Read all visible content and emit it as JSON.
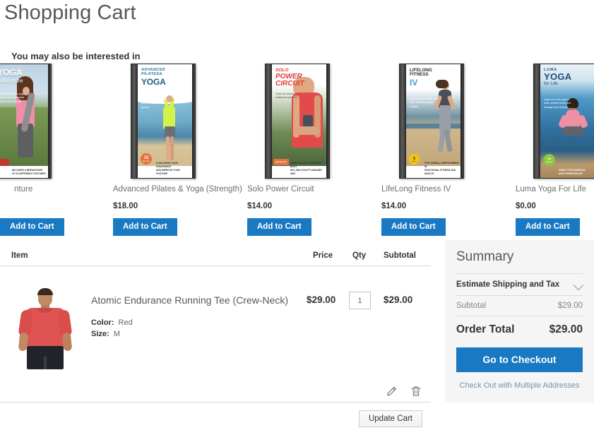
{
  "page": {
    "title": "Shopping Cart"
  },
  "upsell": {
    "heading": "You may also be interested in",
    "add_to_cart_label": "Add to Cart",
    "items": [
      {
        "name": "Yoga Adventure",
        "name_visible": "nture",
        "price": "",
        "art": {
          "line1": "YOGA",
          "line2": "Adventure",
          "blurb": "Start or refine your yoga practice with a personal instructor who follows.",
          "bottom": "INCLUDES A BREAKDOWN OF 32 DIFFERENT POSTURES.",
          "badge": "",
          "badge_color": "#c0392b"
        }
      },
      {
        "name": "Advanced Pilates & Yoga (Strength)",
        "name_visible": "Advanced Pilates & Yoga (Strength)",
        "price": "$18.00",
        "art": {
          "line1": "ADVANCED PILATES &",
          "line2": "YOGA",
          "blurb": "Increase your flexibility and tone even muscle groups.",
          "bottom": "CHALLENGE YOUR ENDURANCE AND IMPROVE YOUR POSTURE.",
          "badge": "15",
          "badge_sub": "Exercises",
          "badge_color": "#e8703a"
        }
      },
      {
        "name": "Solo Power Circuit",
        "name_visible": "Solo Power Circuit",
        "price": "$14.00",
        "art": {
          "line1": "SOLO",
          "line2": "POWER CIRCUIT",
          "blurb": "Twice the fitness of traditional workouts.",
          "bottom": "SHED POUNDS, DECREASE BODY FAT, AND SCULPT AMAZING ABS",
          "badge": "",
          "badge_color": "#e8703a"
        }
      },
      {
        "name": "LifeLong Fitness IV",
        "name_visible": "LifeLong Fitness IV",
        "price": "$14.00",
        "art": {
          "line1": "LIFELONG FITNESS",
          "line2": "IV",
          "blurb": "Improve your health, core and circulation, great mobility.",
          "bottom": "FOR OVERALL IMPROVEMENT IN FUNCTIONAL FITNESS AND HEALTH.",
          "badge": "5",
          "badge_sub": "Fitness Workouts",
          "badge_color": "#f2c313"
        }
      },
      {
        "name": "Luma Yoga For Life",
        "name_visible": "Luma Yoga For Life",
        "price": "$0.00",
        "art": {
          "line1": "LUMA",
          "line2": "YOGA",
          "line3": "for Life",
          "blurb": "Learn how the yoga to relax, soothe stress and manage your anxiety.",
          "bottom": "GREAT FOR EVERYDAY AND STRESS RELIEF.",
          "badge": "Full",
          "badge_sub": "Series",
          "badge_color": "#8cc63f"
        }
      }
    ]
  },
  "cart": {
    "columns": {
      "item": "Item",
      "price": "Price",
      "qty": "Qty",
      "subtotal": "Subtotal"
    },
    "rows": [
      {
        "name": "Atomic Endurance Running Tee (Crew-Neck)",
        "color_label": "Color:",
        "color_value": "Red",
        "size_label": "Size:",
        "size_value": "M",
        "price": "$29.00",
        "qty": "1",
        "subtotal": "$29.00"
      }
    ],
    "update_label": "Update Cart"
  },
  "summary": {
    "title": "Summary",
    "estimate_label": "Estimate Shipping and Tax",
    "subtotal_label": "Subtotal",
    "subtotal_value": "$29.00",
    "total_label": "Order Total",
    "total_value": "$29.00",
    "checkout_label": "Go to Checkout",
    "multi_address_label": "Check Out with Multiple Addresses"
  },
  "colors": {
    "primary_blue": "#1979c3",
    "text_dark": "#333333",
    "text_muted": "#858585",
    "panel_bg": "#f5f5f5",
    "link_blue": "#7b93a8"
  }
}
